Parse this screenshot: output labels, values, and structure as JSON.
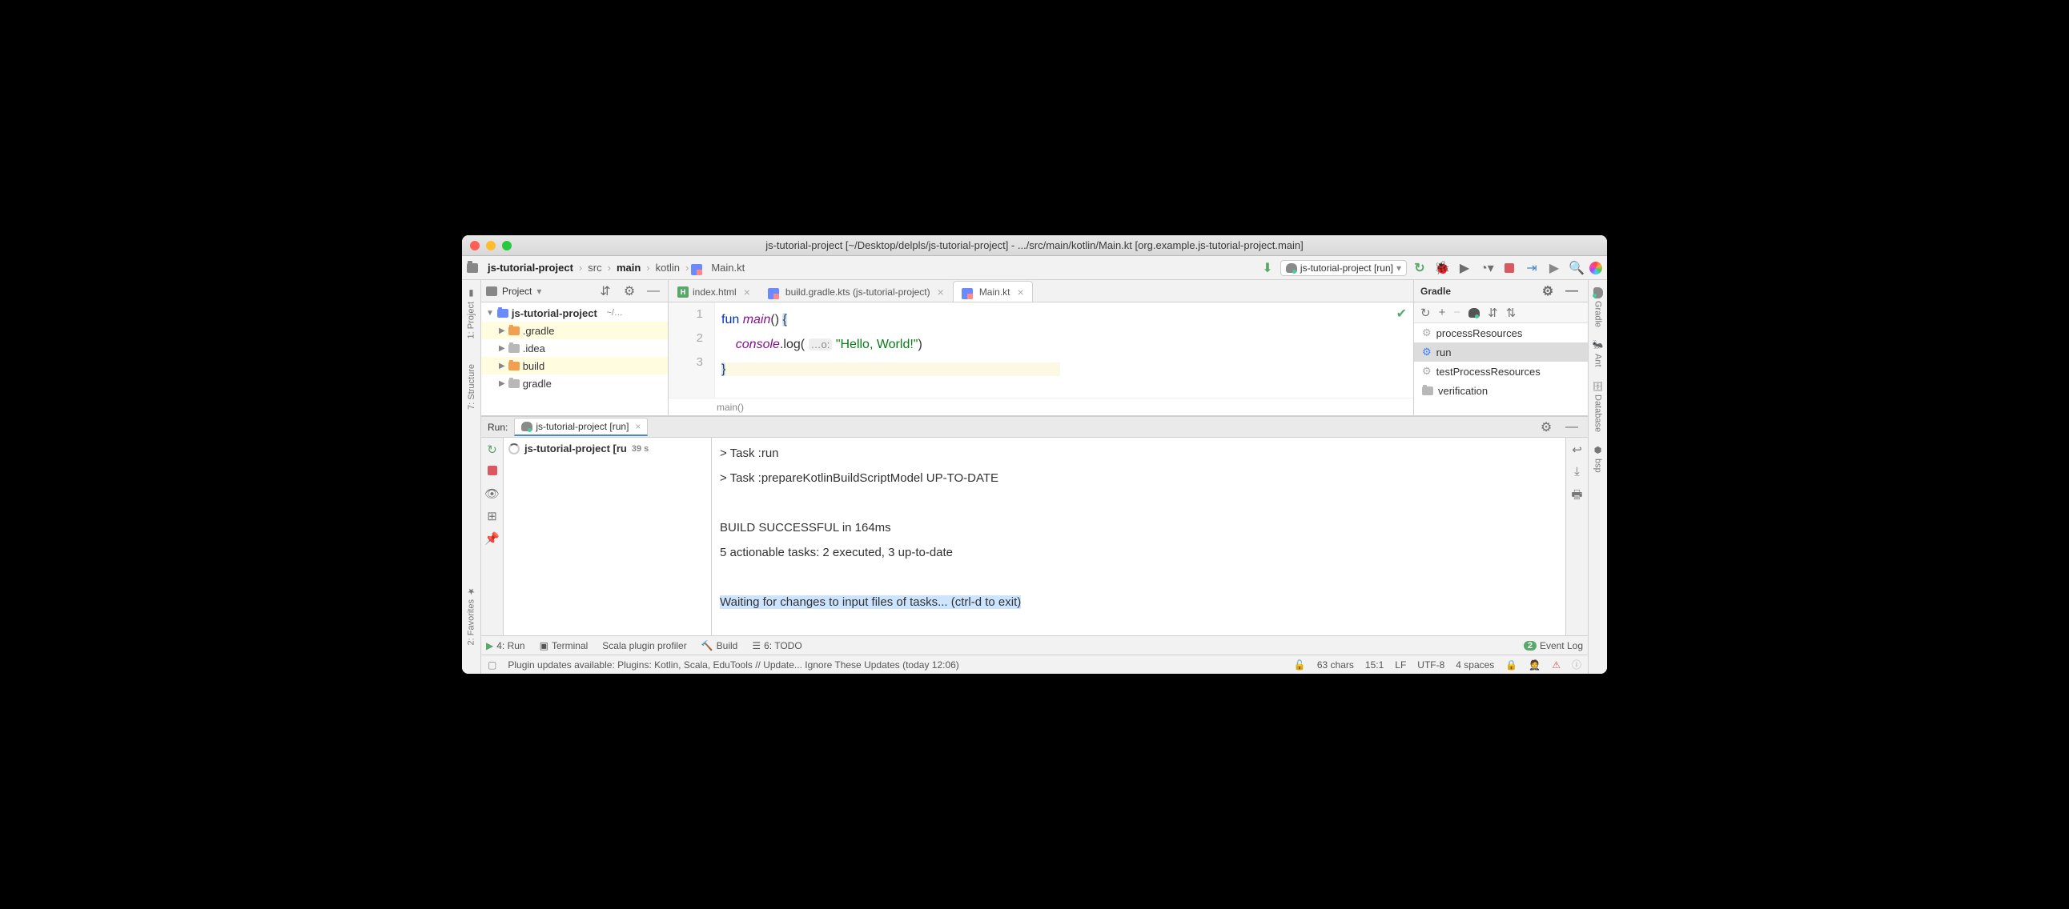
{
  "title": "js-tutorial-project [~/Desktop/delpls/js-tutorial-project] - .../src/main/kotlin/Main.kt [org.example.js-tutorial-project.main]",
  "breadcrumb": {
    "root": "js-tutorial-project",
    "src": "src",
    "main": "main",
    "kotlin": "kotlin",
    "file": "Main.kt"
  },
  "runConfig": "js-tutorial-project [run]",
  "projectPanel": {
    "title": "Project"
  },
  "tree": {
    "root": "js-tutorial-project",
    "rootHint": "~/…",
    "items": [
      ".gradle",
      ".idea",
      "build",
      "gradle"
    ]
  },
  "tabs": [
    {
      "name": "index.html",
      "icon": "h"
    },
    {
      "name": "build.gradle.kts (js-tutorial-project)",
      "icon": "kt"
    },
    {
      "name": "Main.kt",
      "icon": "kt",
      "active": true
    }
  ],
  "editor": {
    "lines": [
      "1",
      "2",
      "3"
    ],
    "code1_kw": "fun ",
    "code1_fn": "main",
    "code1_rest": "() ",
    "code1_brace": "{",
    "code2_a": "    ",
    "code2_obj": "console",
    "code2_b": ".log( ",
    "code2_hint": "…o:",
    "code2_c": " ",
    "code2_str": "\"Hello, World!\"",
    "code2_d": ")",
    "code3": "}",
    "crumb": "main()"
  },
  "gradle": {
    "title": "Gradle",
    "tasks": [
      "processResources",
      "run",
      "testProcessResources",
      "verification"
    ]
  },
  "leftTabs": [
    "1: Project",
    "7: Structure",
    "2: Favorites"
  ],
  "rightTabs": [
    "Gradle",
    "Ant",
    "Database",
    "bsp"
  ],
  "run": {
    "label": "Run:",
    "tab": "js-tutorial-project [run]",
    "treeItem": "js-tutorial-project [ru",
    "duration": "39 s",
    "lines": [
      "> Task :run",
      "> Task :prepareKotlinBuildScriptModel UP-TO-DATE",
      "",
      "BUILD SUCCESSFUL in 164ms",
      "5 actionable tasks: 2 executed, 3 up-to-date",
      ""
    ],
    "highlighted": "Waiting for changes to input files of tasks... (ctrl-d to exit)"
  },
  "bottomTabs": {
    "run": "4: Run",
    "terminal": "Terminal",
    "scala": "Scala plugin profiler",
    "build": "Build",
    "todo": "6: TODO",
    "eventLog": "Event Log",
    "eventCount": "2"
  },
  "status": {
    "msg": "Plugin updates available: Plugins: Kotlin, Scala, EduTools // Update...   Ignore These Updates (today 12:06)",
    "chars": "63 chars",
    "pos": "15:1",
    "lf": "LF",
    "enc": "UTF-8",
    "indent": "4 spaces"
  }
}
